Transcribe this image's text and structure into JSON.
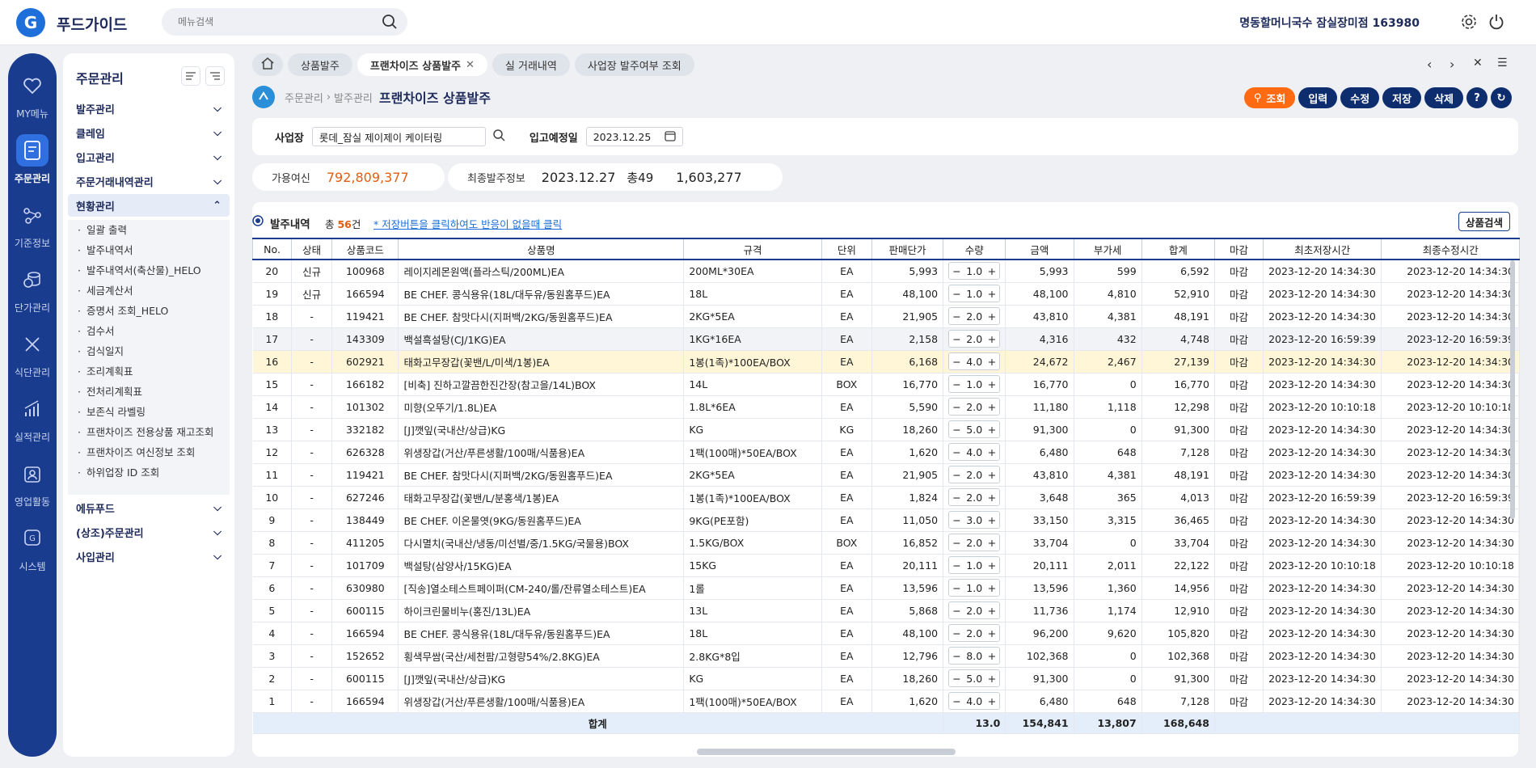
{
  "app": {
    "logo_letter": "G",
    "name": "푸드가이드",
    "search_placeholder": "메뉴검색",
    "store": "명동할머니국수 잠실장미점 163980"
  },
  "leftnav": [
    {
      "label": "MY메뉴",
      "icon": "heart-icon"
    },
    {
      "label": "주문관리",
      "icon": "order-doc-icon",
      "active": true
    },
    {
      "label": "기준정보",
      "icon": "network-icon"
    },
    {
      "label": "단가관리",
      "icon": "coins-icon"
    },
    {
      "label": "식단관리",
      "icon": "utensils-icon"
    },
    {
      "label": "실적관리",
      "icon": "chart-icon"
    },
    {
      "label": "영업활동",
      "icon": "badge-icon"
    },
    {
      "label": "시스템",
      "icon": "system-icon"
    }
  ],
  "submenu": {
    "title": "주문관리",
    "groups_top": [
      "발주관리",
      "클레임",
      "입고관리",
      "주문거래내역관리"
    ],
    "open_group": "현황관리",
    "items": [
      "일괄 출력",
      "발주내역서",
      "발주내역서(축산물)_HELO",
      "세금계산서",
      "증명서 조회_HELO",
      "검수서",
      "검식일지",
      "조리계획표",
      "전처리계획표",
      "보존식 라벨링",
      "프랜차이즈 전용상품 재고조회",
      "프랜차이즈 여신정보 조회",
      "하위업장 ID 조회"
    ],
    "groups_bottom": [
      "에듀푸드",
      "(상조)주문관리",
      "사입관리"
    ]
  },
  "tabs": [
    "상품발주",
    "프랜차이즈 상품발주",
    "실 거래내역",
    "사업장 발주여부 조회"
  ],
  "breadcrumb": {
    "l1": "주문관리",
    "l2": "발주관리",
    "title": "프랜차이즈 상품발주"
  },
  "buttons": {
    "search": "조회",
    "input": "입력",
    "edit": "수정",
    "save": "저장",
    "delete": "삭제",
    "help": "?"
  },
  "filter": {
    "site_label": "사업장",
    "site_value": "롯데_잠실 제이제이 케이터링",
    "date_label": "입고예정일",
    "date_value": "2023.12.25"
  },
  "info": {
    "credit_label": "가용여신",
    "credit_value": "792,809,377",
    "last_label": "최종발주정보",
    "last_date": "2023.12.27",
    "last_count": "총49",
    "last_amount": "1,603,277"
  },
  "table_meta": {
    "title": "발주내역",
    "total_prefix": "총 ",
    "total_count": "56",
    "total_suffix": "건",
    "notice": "* 저장버튼을 클릭하여도 반응이 없을때 클릭",
    "product_search": "상품검색"
  },
  "columns": [
    "No.",
    "상태",
    "상품코드",
    "상품명",
    "규격",
    "단위",
    "판매단가",
    "수량",
    "금액",
    "부가세",
    "합계",
    "마감",
    "최초저장시간",
    "최종수정시간"
  ],
  "rows": [
    [
      "20",
      "신규",
      "100968",
      "레이지레몬원액(플라스틱/200ML)EA",
      "200ML*30EA",
      "EA",
      "5,993",
      "1.0",
      "5,993",
      "599",
      "6,592",
      "마감",
      "2023-12-20 14:34:30",
      "2023-12-20 14:34:30"
    ],
    [
      "19",
      "신규",
      "166594",
      "BE CHEF. 콩식용유(18L/대두유/동원홈푸드)EA",
      "18L",
      "EA",
      "48,100",
      "1.0",
      "48,100",
      "4,810",
      "52,910",
      "마감",
      "2023-12-20 14:34:30",
      "2023-12-20 14:34:30"
    ],
    [
      "18",
      "-",
      "119421",
      "BE CHEF. 참맛다시(지퍼백/2KG/동원홈푸드)EA",
      "2KG*5EA",
      "EA",
      "21,905",
      "2.0",
      "43,810",
      "4,381",
      "48,191",
      "마감",
      "2023-12-20 14:34:30",
      "2023-12-20 14:34:30"
    ],
    [
      "17",
      "-",
      "143309",
      "백설흑설탕(CJ/1KG)EA",
      "1KG*16EA",
      "EA",
      "2,158",
      "2.0",
      "4,316",
      "432",
      "4,748",
      "마감",
      "2023-12-20 16:59:39",
      "2023-12-20 16:59:39"
    ],
    [
      "16",
      "-",
      "602921",
      "태화고무장갑(꽃밴/L/미색/1봉)EA",
      "1봉(1족)*100EA/BOX",
      "EA",
      "6,168",
      "4.0",
      "24,672",
      "2,467",
      "27,139",
      "마감",
      "2023-12-20 14:34:30",
      "2023-12-20 14:34:30"
    ],
    [
      "15",
      "-",
      "166182",
      "[비축] 진하고깔끔한진간장(참고을/14L)BOX",
      "14L",
      "BOX",
      "16,770",
      "1.0",
      "16,770",
      "0",
      "16,770",
      "마감",
      "2023-12-20 14:34:30",
      "2023-12-20 14:34:30"
    ],
    [
      "14",
      "-",
      "101302",
      "미향(오뚜기/1.8L)EA",
      "1.8L*6EA",
      "EA",
      "5,590",
      "2.0",
      "11,180",
      "1,118",
      "12,298",
      "마감",
      "2023-12-20 10:10:18",
      "2023-12-20 10:10:18"
    ],
    [
      "13",
      "-",
      "332182",
      "[J]깻잎(국내산/상급)KG",
      "KG",
      "KG",
      "18,260",
      "5.0",
      "91,300",
      "0",
      "91,300",
      "마감",
      "2023-12-20 14:34:30",
      "2023-12-20 14:34:30"
    ],
    [
      "12",
      "-",
      "626328",
      "위생장갑(거산/푸른생활/100매/식품용)EA",
      "1팩(100매)*50EA/BOX",
      "EA",
      "1,620",
      "4.0",
      "6,480",
      "648",
      "7,128",
      "마감",
      "2023-12-20 14:34:30",
      "2023-12-20 14:34:30"
    ],
    [
      "11",
      "-",
      "119421",
      "BE CHEF. 참맛다시(지퍼백/2KG/동원홈푸드)EA",
      "2KG*5EA",
      "EA",
      "21,905",
      "2.0",
      "43,810",
      "4,381",
      "48,191",
      "마감",
      "2023-12-20 14:34:30",
      "2023-12-20 14:34:30"
    ],
    [
      "10",
      "-",
      "627246",
      "태화고무장갑(꽃밴/L/분홍색/1봉)EA",
      "1봉(1족)*100EA/BOX",
      "EA",
      "1,824",
      "2.0",
      "3,648",
      "365",
      "4,013",
      "마감",
      "2023-12-20 16:59:39",
      "2023-12-20 16:59:39"
    ],
    [
      "9",
      "-",
      "138449",
      "BE CHEF. 이온물엿(9KG/동원홈푸드)EA",
      "9KG(PE포함)",
      "EA",
      "11,050",
      "3.0",
      "33,150",
      "3,315",
      "36,465",
      "마감",
      "2023-12-20 14:34:30",
      "2023-12-20 14:34:30"
    ],
    [
      "8",
      "-",
      "411205",
      "다시멸치(국내산/냉동/미선별/중/1.5KG/국물용)BOX",
      "1.5KG/BOX",
      "BOX",
      "16,852",
      "2.0",
      "33,704",
      "0",
      "33,704",
      "마감",
      "2023-12-20 14:34:30",
      "2023-12-20 14:34:30"
    ],
    [
      "7",
      "-",
      "101709",
      "백설탕(삼양사/15KG)EA",
      "15KG",
      "EA",
      "20,111",
      "1.0",
      "20,111",
      "2,011",
      "22,122",
      "마감",
      "2023-12-20 10:10:18",
      "2023-12-20 10:10:18"
    ],
    [
      "6",
      "-",
      "630980",
      "[직송]열소테스트페이퍼(CM-240/롤/잔류열소테스트)EA",
      "1롤",
      "EA",
      "13,596",
      "1.0",
      "13,596",
      "1,360",
      "14,956",
      "마감",
      "2023-12-20 14:34:30",
      "2023-12-20 14:34:30"
    ],
    [
      "5",
      "-",
      "600115",
      "하이크린물비누(홍진/13L)EA",
      "13L",
      "EA",
      "5,868",
      "2.0",
      "11,736",
      "1,174",
      "12,910",
      "마감",
      "2023-12-20 14:34:30",
      "2023-12-20 14:34:30"
    ],
    [
      "4",
      "-",
      "166594",
      "BE CHEF. 콩식용유(18L/대두유/동원홈푸드)EA",
      "18L",
      "EA",
      "48,100",
      "2.0",
      "96,200",
      "9,620",
      "105,820",
      "마감",
      "2023-12-20 14:34:30",
      "2023-12-20 14:34:30"
    ],
    [
      "3",
      "-",
      "152652",
      "횡색무쌈(국산/세천팜/고형량54%/2.8KG)EA",
      "2.8KG*8입",
      "EA",
      "12,796",
      "8.0",
      "102,368",
      "0",
      "102,368",
      "마감",
      "2023-12-20 14:34:30",
      "2023-12-20 14:34:30"
    ],
    [
      "2",
      "-",
      "600115",
      "[J]깻잎(국내산/상급)KG",
      "KG",
      "EA",
      "18,260",
      "5.0",
      "91,300",
      "0",
      "91,300",
      "마감",
      "2023-12-20 14:34:30",
      "2023-12-20 14:34:30"
    ],
    [
      "1",
      "-",
      "166594",
      "위생장갑(거산/푸른생활/100매/식품용)EA",
      "1팩(100매)*50EA/BOX",
      "EA",
      "1,620",
      "4.0",
      "6,480",
      "648",
      "7,128",
      "마감",
      "2023-12-20 14:34:30",
      "2023-12-20 14:34:30"
    ]
  ],
  "summary": {
    "label": "합계",
    "qty": "13.0",
    "amount": "154,841",
    "vat": "13,807",
    "total": "168,648"
  },
  "colors": {
    "brand": "#1a3c8f",
    "accent": "#ff6a13",
    "highlight": "#fff6d8"
  }
}
